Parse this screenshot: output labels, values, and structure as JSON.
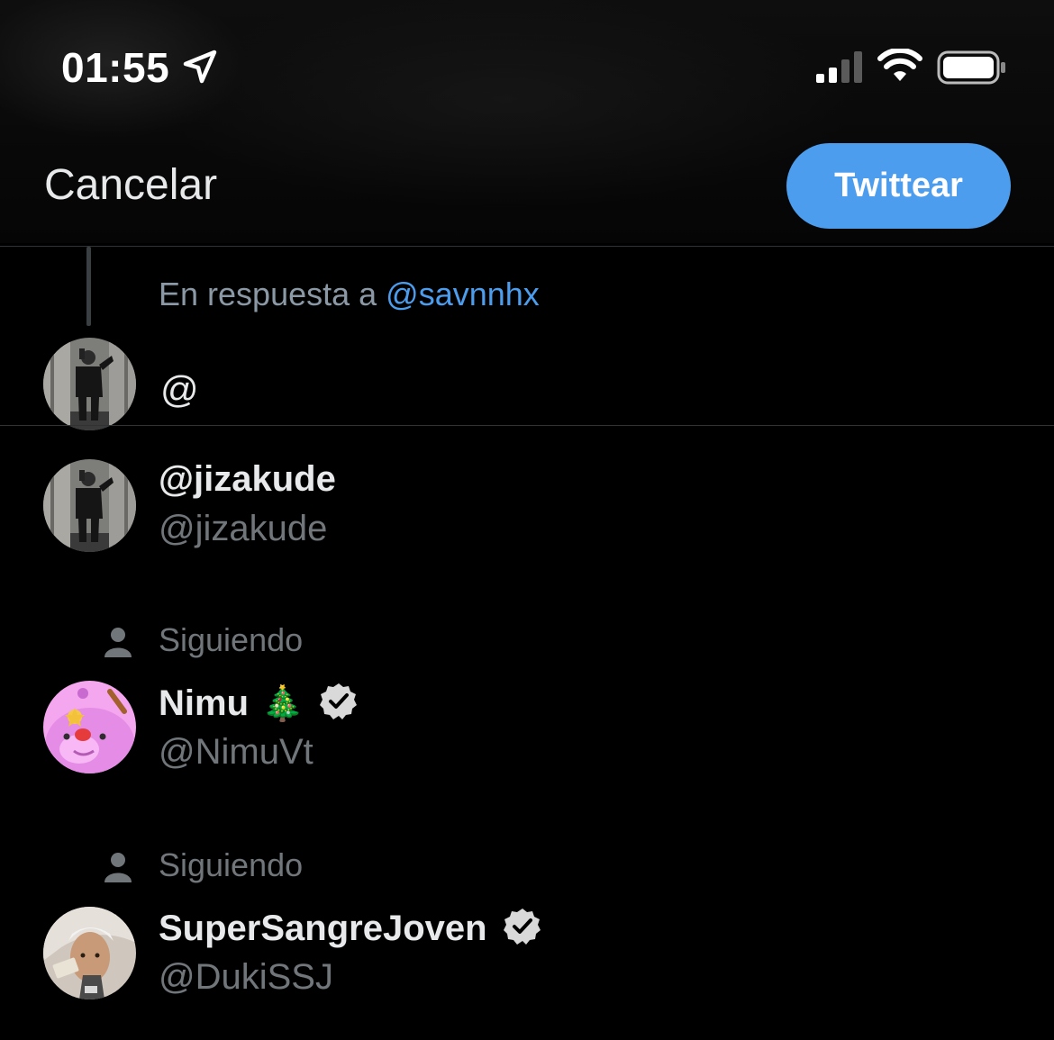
{
  "status_bar": {
    "time": "01:55"
  },
  "header": {
    "cancel_label": "Cancelar",
    "tweet_label": "Twittear"
  },
  "reply": {
    "prefix": "En respuesta a ",
    "mention": "@savnnhx"
  },
  "compose": {
    "value": "@"
  },
  "suggestions": [
    {
      "name": "@jizakude",
      "handle": "@jizakude",
      "following_label": "",
      "verified": false,
      "emoji": ""
    },
    {
      "name": "Nimu",
      "emoji": "🎄",
      "handle": "@NimuVt",
      "following_label": "Siguiendo",
      "verified": true
    },
    {
      "name": "SuperSangreJoven",
      "emoji": "",
      "handle": "@DukiSSJ",
      "following_label": "Siguiendo",
      "verified": true
    }
  ],
  "colors": {
    "accent": "#4c9ded",
    "background": "#000000",
    "muted": "#71767b"
  }
}
